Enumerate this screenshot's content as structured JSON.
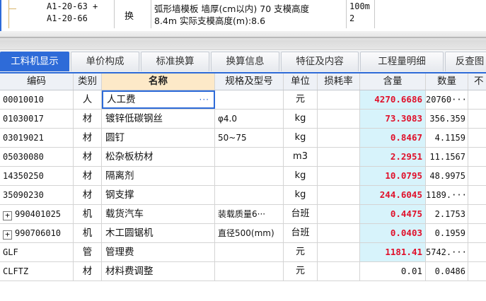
{
  "top_row": {
    "code_line1": "A1-20-63 +",
    "code_line2": "A1-20-66",
    "type": "换",
    "name_line1": "弧形墙模板 墙厚(cm以内) 70 支模高度",
    "name_line2": "8.4m  实际支模高度(m):8.6",
    "qty_line1": "100m",
    "qty_line2": "2"
  },
  "tabs": [
    {
      "label": "工料机显示",
      "active": true
    },
    {
      "label": "单价构成"
    },
    {
      "label": "标准换算"
    },
    {
      "label": "换算信息"
    },
    {
      "label": "特征及内容"
    },
    {
      "label": "工程量明细"
    },
    {
      "label": "反查图"
    }
  ],
  "columns": {
    "code": "编码",
    "type": "类别",
    "name": "名称",
    "spec": "规格及型号",
    "unit": "单位",
    "loss": "损耗率",
    "amount": "含量",
    "qty": "数量",
    "extra": "不"
  },
  "rows": [
    {
      "code": "00010010",
      "type": "人",
      "name": "人工费",
      "spec": "",
      "unit": "元",
      "amount": "4270.6686",
      "qty": "20760···"
    },
    {
      "code": "01030017",
      "type": "材",
      "name": "镀锌低碳钢丝",
      "spec": "φ4.0",
      "unit": "kg",
      "amount": "73.3083",
      "qty": "356.359"
    },
    {
      "code": "03019021",
      "type": "材",
      "name": "圆钉",
      "spec": "50~75",
      "unit": "kg",
      "amount": "0.8467",
      "qty": "4.1159"
    },
    {
      "code": "05030080",
      "type": "材",
      "name": "松杂板枋材",
      "spec": "",
      "unit": "m3",
      "amount": "2.2951",
      "qty": "11.1567"
    },
    {
      "code": "14350250",
      "type": "材",
      "name": "隔离剂",
      "spec": "",
      "unit": "kg",
      "amount": "10.0795",
      "qty": "48.9975"
    },
    {
      "code": "35090230",
      "type": "材",
      "name": "钢支撑",
      "spec": "",
      "unit": "kg",
      "amount": "244.6045",
      "qty": "1189.···"
    },
    {
      "code": "990401025",
      "type": "机",
      "name": "载货汽车",
      "spec": "装载质量6···",
      "unit": "台班",
      "amount": "0.4475",
      "qty": "2.1753",
      "expandable": true
    },
    {
      "code": "990706010",
      "type": "机",
      "name": "木工圆锯机",
      "spec": "直径500(mm)",
      "unit": "台班",
      "amount": "0.0403",
      "qty": "0.1959",
      "expandable": true
    },
    {
      "code": "GLF",
      "type": "管",
      "name": "管理费",
      "spec": "",
      "unit": "元",
      "amount": "1181.41",
      "qty": "5742.···"
    },
    {
      "code": "CLFTZ",
      "type": "材",
      "name": "材料费调整",
      "spec": "",
      "unit": "元",
      "amount": "0.01",
      "qty": "0.0486",
      "plain_amount": true
    }
  ],
  "expander_glyph": "+",
  "ellipsis": "···",
  "colors": {
    "accent": "#2e6bd8",
    "amount_text": "#e0102a",
    "amount_bg": "#d7f3fb",
    "name_header_bg": "#fde9c8"
  }
}
